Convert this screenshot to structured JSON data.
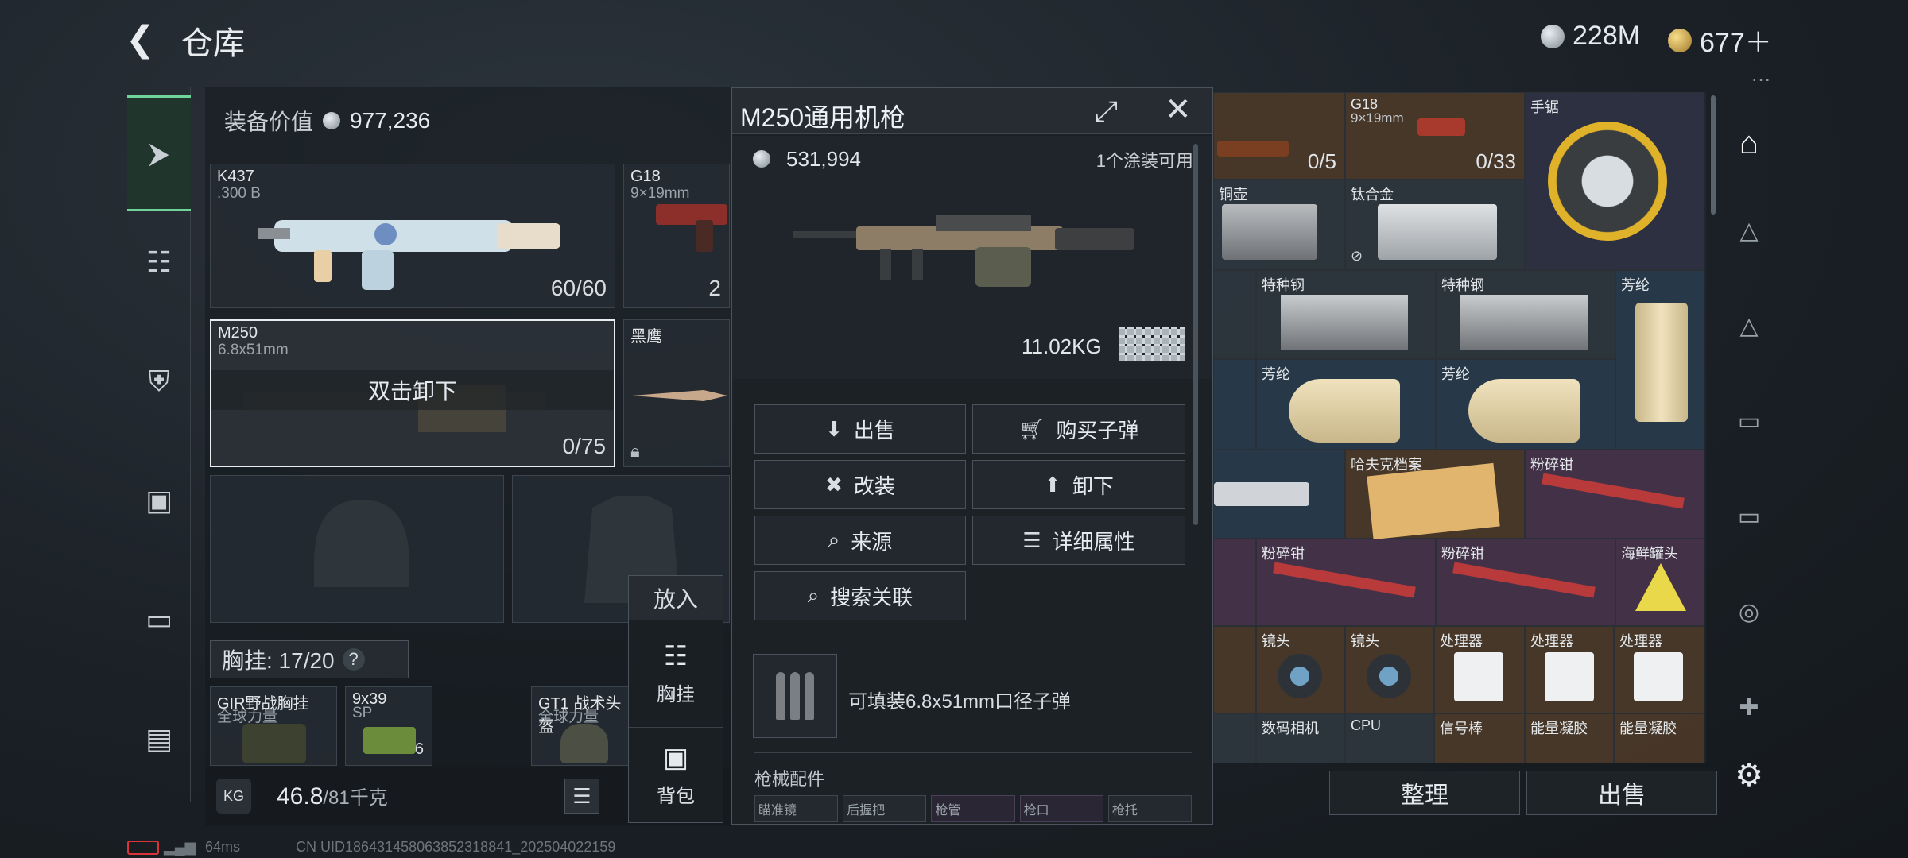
{
  "header": {
    "title": "仓库",
    "currency_silver": "228M",
    "currency_gold": "677＋"
  },
  "loadout": {
    "value_label": "装备价值",
    "value": "977,236",
    "weapons": [
      {
        "name": "K437",
        "caliber": ".300 B",
        "ammo": "60/60"
      },
      {
        "name": "G18",
        "caliber": "9×19mm",
        "ammo": "2"
      },
      {
        "name": "M250",
        "caliber": "6.8x51mm",
        "ammo": "0/75",
        "overlay": "双击卸下"
      },
      {
        "name": "黑鹰",
        "caliber": "",
        "ammo": ""
      }
    ],
    "rig_label": "胸挂: 17/20",
    "rig_help": "?",
    "rig_items": [
      {
        "name": "GIR野战胸挂",
        "sub": "全球力量"
      },
      {
        "name": "9x39",
        "sub": "SP",
        "count": "6"
      },
      {
        "name": "GT1 战术头盔",
        "sub": "全球力量"
      }
    ],
    "weight": "46.8",
    "weight_max": "/81千克"
  },
  "put_in": {
    "title": "放入",
    "rig": "胸挂",
    "backpack": "背包"
  },
  "popup": {
    "title": "M250通用机枪",
    "price": "531,994",
    "skin_note": "1个涂装可用",
    "weight": "11.02KG",
    "buttons": {
      "sell": "出售",
      "buy_ammo": "购买子弹",
      "modify": "改装",
      "unload": "卸下",
      "source": "来源",
      "details": "详细属性",
      "search_related": "搜索关联"
    },
    "ammo_note": "可填装6.8x51mm口径子弹",
    "attachments_label": "枪械配件",
    "attachment_slots": [
      "瞄准镜",
      "后握把",
      "枪管",
      "枪口",
      "枪托"
    ]
  },
  "storage": {
    "items": [
      {
        "name": "",
        "sub": "",
        "count": "0/5"
      },
      {
        "name": "G18",
        "sub": "9×19mm",
        "count": "0/33"
      },
      {
        "name": "手锯",
        "sub": "",
        "count": ""
      },
      {
        "name": "铜壶",
        "sub": "",
        "count": ""
      },
      {
        "name": "钛合金",
        "sub": "",
        "count": ""
      },
      {
        "name": "特种钢",
        "sub": "",
        "count": ""
      },
      {
        "name": "特种钢",
        "sub": "",
        "count": ""
      },
      {
        "name": "芳纶",
        "sub": "",
        "count": ""
      },
      {
        "name": "芳纶",
        "sub": "",
        "count": ""
      },
      {
        "name": "芳纶",
        "sub": "",
        "count": ""
      },
      {
        "name": "哈夫克档案",
        "sub": "",
        "count": ""
      },
      {
        "name": "粉碎钳",
        "sub": "",
        "count": ""
      },
      {
        "name": "粉碎钳",
        "sub": "",
        "count": ""
      },
      {
        "name": "粉碎钳",
        "sub": "",
        "count": ""
      },
      {
        "name": "海鲜罐头",
        "sub": "",
        "count": ""
      },
      {
        "name": "镜头",
        "sub": "",
        "count": ""
      },
      {
        "name": "镜头",
        "sub": "",
        "count": ""
      },
      {
        "name": "处理器",
        "sub": "",
        "count": ""
      },
      {
        "name": "处理器",
        "sub": "",
        "count": ""
      },
      {
        "name": "处理器",
        "sub": "",
        "count": ""
      },
      {
        "name": "数码相机",
        "sub": "",
        "count": ""
      },
      {
        "name": "CPU",
        "sub": "",
        "count": ""
      },
      {
        "name": "信号棒",
        "sub": "",
        "count": ""
      },
      {
        "name": "能量凝胶",
        "sub": "",
        "count": ""
      },
      {
        "name": "能量凝胶",
        "sub": "",
        "count": ""
      }
    ],
    "sort_button": "整理",
    "sell_button": "出售"
  },
  "status": {
    "ping": "64ms",
    "uid": "CN UID18643145806385231884​1_202504022159"
  },
  "colors": {
    "accent": "#6fd39a",
    "panel": "#1c2126",
    "brown_cell": "#4a3828",
    "blue_cell": "#283a4a"
  }
}
